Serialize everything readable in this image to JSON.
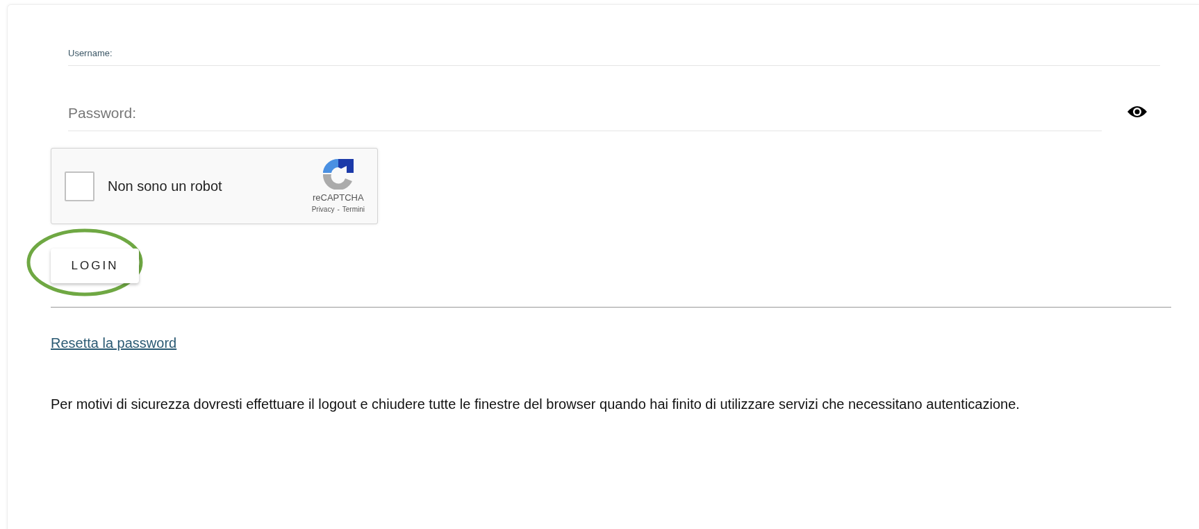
{
  "fields": [
    {
      "kind": "text",
      "label": "Username:"
    },
    {
      "kind": "password",
      "placeholder": "Password:"
    }
  ],
  "captcha": {
    "checked": false,
    "label": "Non sono un robot",
    "brand": "reCAPTCHA",
    "links": [
      "Privacy",
      "-",
      "Termini"
    ]
  },
  "login_button": {
    "label": "LOGIN",
    "highlighted": true
  },
  "reset_link": "Resetta la password",
  "notice": "Per motivi di sicurezza dovresti effettuare il logout e chiudere tutte le finestre del browser quando hai finito di utilizzare servizi che necessitano autenticazione."
}
